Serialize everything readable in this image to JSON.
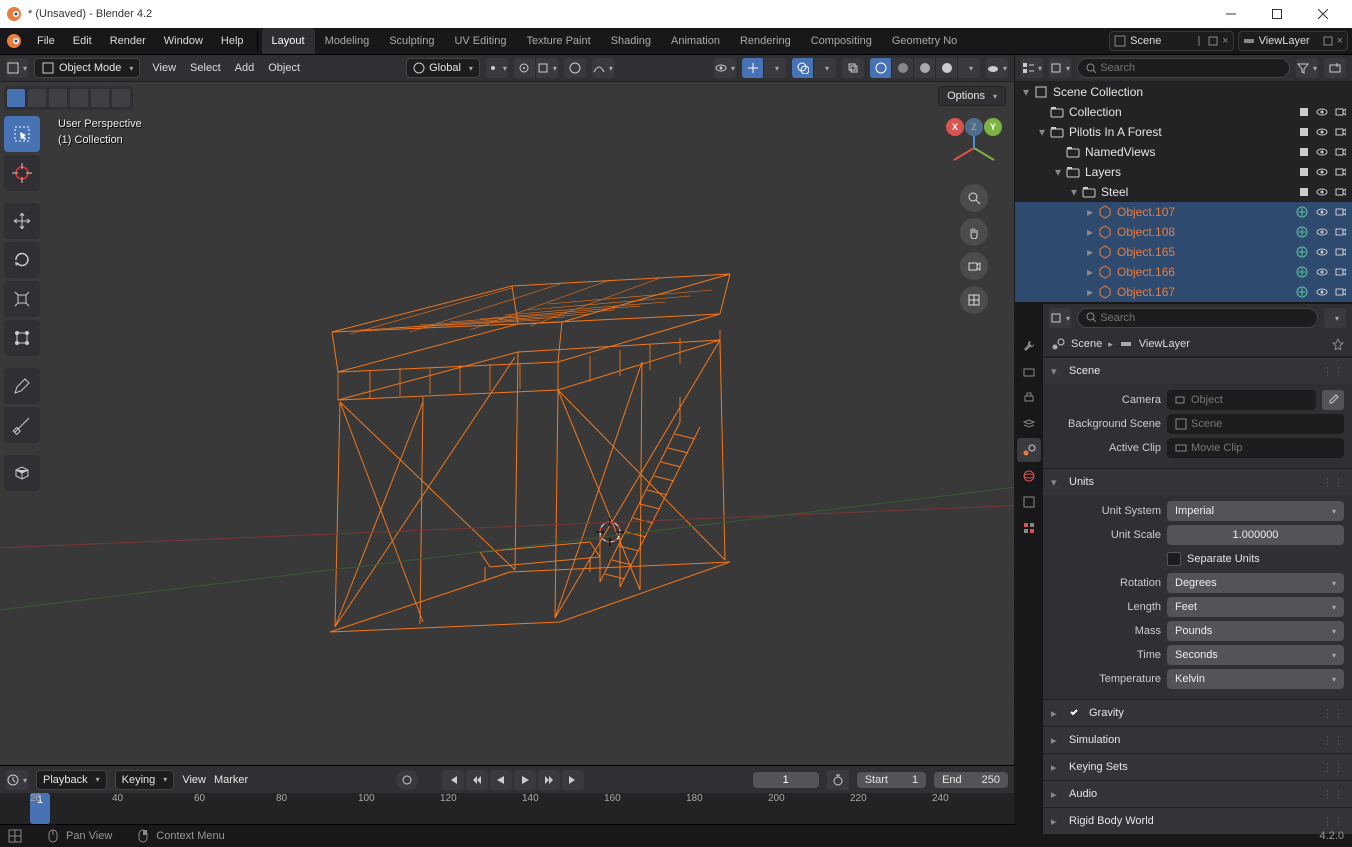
{
  "title": "* (Unsaved) - Blender 4.2",
  "version": "4.2.0",
  "topmenu": {
    "items": [
      "File",
      "Edit",
      "Render",
      "Window",
      "Help"
    ]
  },
  "workspace_tabs": [
    "Layout",
    "Modeling",
    "Sculpting",
    "UV Editing",
    "Texture Paint",
    "Shading",
    "Animation",
    "Rendering",
    "Compositing",
    "Geometry No"
  ],
  "workspace_active": "Layout",
  "scene_field": {
    "label": "Scene"
  },
  "viewlayer_field": {
    "label": "ViewLayer"
  },
  "vpheader": {
    "mode": "Object Mode",
    "menus": [
      "View",
      "Select",
      "Add",
      "Object"
    ],
    "orientation": "Global",
    "options_label": "Options"
  },
  "viewport_info": {
    "line1": "User Perspective",
    "line2": "(1) Collection"
  },
  "outliner": {
    "search_placeholder": "Search",
    "tree": [
      {
        "depth": 0,
        "expand": "open",
        "icon": "scene",
        "label": "Scene Collection",
        "sel": false,
        "objcolor": false,
        "rbtns": false,
        "icon2": null
      },
      {
        "depth": 1,
        "expand": "leaf",
        "icon": "coll",
        "label": "Collection",
        "sel": false,
        "objcolor": false,
        "rbtns": true,
        "icon2": null
      },
      {
        "depth": 1,
        "expand": "open",
        "icon": "coll",
        "label": "Pilotis In A Forest",
        "sel": false,
        "objcolor": false,
        "rbtns": true,
        "icon2": null
      },
      {
        "depth": 2,
        "expand": "leaf",
        "icon": "coll",
        "label": "NamedViews",
        "sel": false,
        "objcolor": false,
        "rbtns": true,
        "icon2": null
      },
      {
        "depth": 2,
        "expand": "open",
        "icon": "coll",
        "label": "Layers",
        "sel": false,
        "objcolor": false,
        "rbtns": true,
        "icon2": null
      },
      {
        "depth": 3,
        "expand": "open",
        "icon": "coll",
        "label": "Steel",
        "sel": false,
        "objcolor": false,
        "rbtns": true,
        "icon2": null
      },
      {
        "depth": 4,
        "expand": "closed",
        "icon": "mesh",
        "label": "Object.107",
        "sel": true,
        "objcolor": true,
        "rbtns": true,
        "icon2": "mat"
      },
      {
        "depth": 4,
        "expand": "closed",
        "icon": "mesh",
        "label": "Object.108",
        "sel": true,
        "objcolor": true,
        "rbtns": true,
        "icon2": "mat"
      },
      {
        "depth": 4,
        "expand": "closed",
        "icon": "mesh",
        "label": "Object.165",
        "sel": true,
        "objcolor": true,
        "rbtns": true,
        "icon2": "mat"
      },
      {
        "depth": 4,
        "expand": "closed",
        "icon": "mesh",
        "label": "Object.166",
        "sel": true,
        "objcolor": true,
        "rbtns": true,
        "icon2": "mat"
      },
      {
        "depth": 4,
        "expand": "closed",
        "icon": "mesh",
        "label": "Object.167",
        "sel": true,
        "objcolor": true,
        "rbtns": true,
        "icon2": "mat"
      }
    ]
  },
  "props": {
    "breadcrumb": {
      "scene": "Scene",
      "layer": "ViewLayer"
    },
    "scene_panel": {
      "title": "Scene",
      "camera_label": "Camera",
      "camera_placeholder": "Object",
      "bgscene_label": "Background Scene",
      "bgscene_placeholder": "Scene",
      "clip_label": "Active Clip",
      "clip_placeholder": "Movie Clip"
    },
    "units_panel": {
      "title": "Units",
      "system_label": "Unit System",
      "system_value": "Imperial",
      "scale_label": "Unit Scale",
      "scale_value": "1.000000",
      "separate_label": "Separate Units",
      "rotation_label": "Rotation",
      "rotation_value": "Degrees",
      "length_label": "Length",
      "length_value": "Feet",
      "mass_label": "Mass",
      "mass_value": "Pounds",
      "time_label": "Time",
      "time_value": "Seconds",
      "temp_label": "Temperature",
      "temp_value": "Kelvin"
    },
    "collapsed": [
      "Gravity",
      "Simulation",
      "Keying Sets",
      "Audio",
      "Rigid Body World"
    ],
    "gravity_checked": true
  },
  "timeline": {
    "playback": "Playback",
    "keying": "Keying",
    "view": "View",
    "marker": "Marker",
    "current": "1",
    "start_label": "Start",
    "start": "1",
    "end_label": "End",
    "end": "250",
    "ticks": [
      "20",
      "40",
      "60",
      "80",
      "100",
      "120",
      "140",
      "160",
      "180",
      "200",
      "220",
      "240"
    ],
    "cursor": "1"
  },
  "status": {
    "pan": "Pan View",
    "ctx": "Context Menu"
  }
}
